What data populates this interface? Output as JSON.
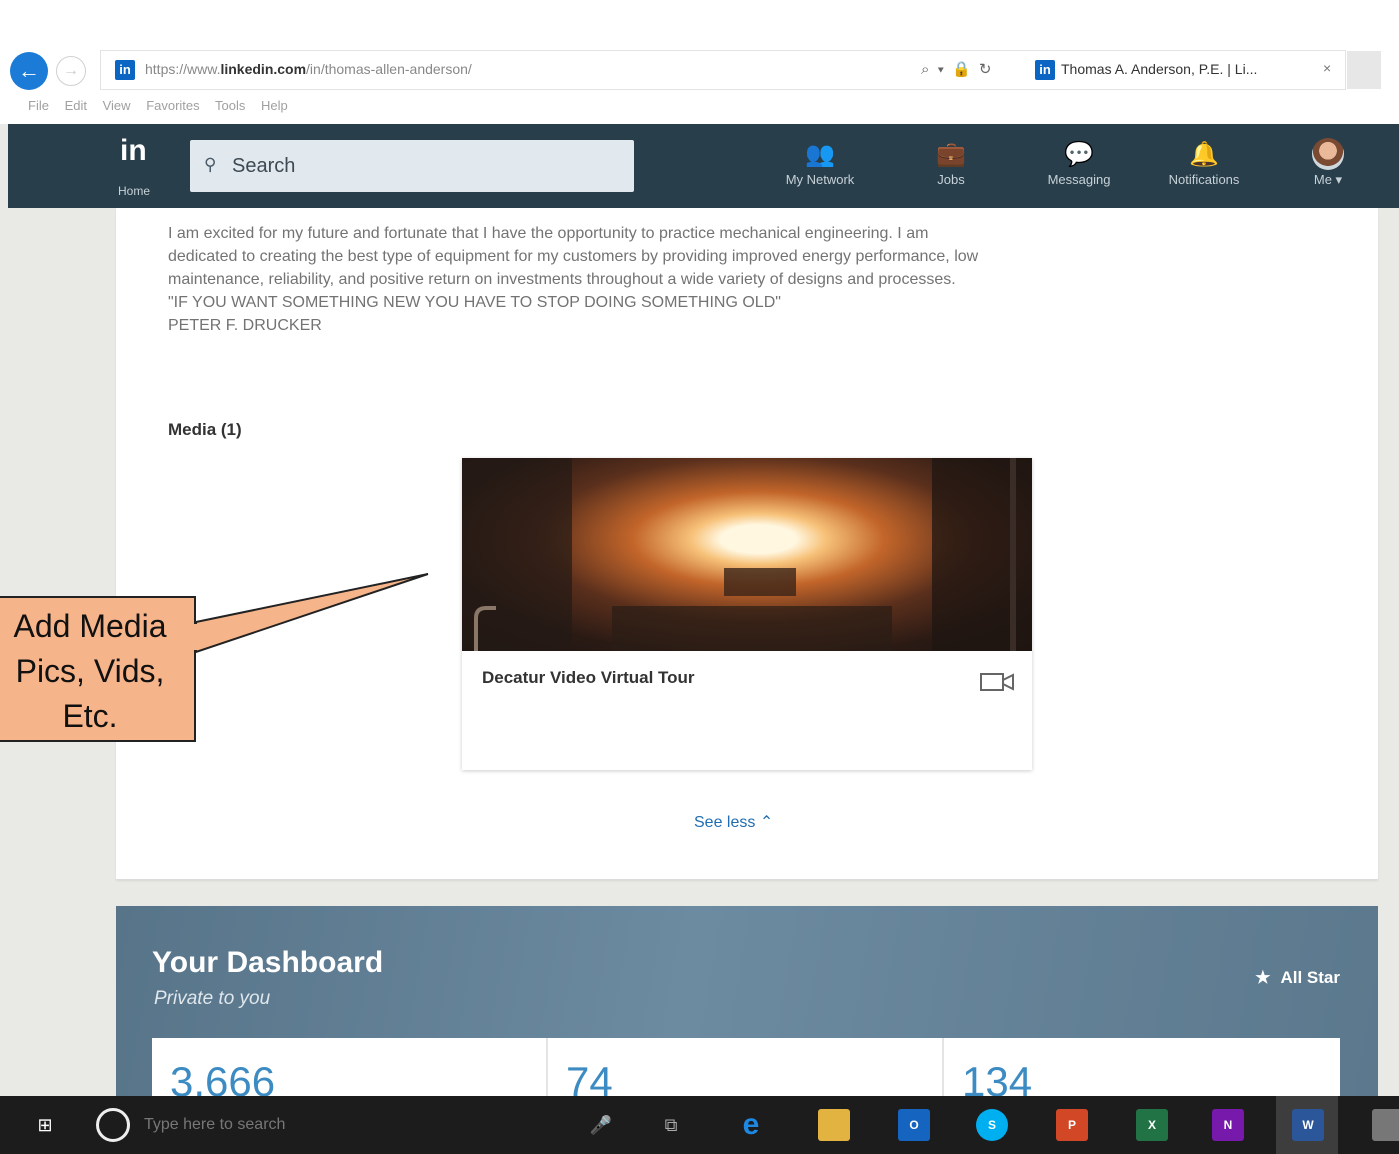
{
  "browser": {
    "url_prefix": "https://www.",
    "url_domain": "linkedin.com",
    "url_path": "/in/thomas-allen-anderson/",
    "address_icons": "⌕ ▾ 🔒 ↻",
    "tab_title": "Thomas A. Anderson, P.E. | Li...",
    "tab_close": "×",
    "menu": [
      "File",
      "Edit",
      "View",
      "Favorites",
      "Tools",
      "Help"
    ]
  },
  "nav": {
    "logo": "in",
    "home_label": "Home",
    "search_placeholder": "Search",
    "items": [
      {
        "label": "My Network",
        "icon": "people-icon"
      },
      {
        "label": "Jobs",
        "icon": "briefcase-icon"
      },
      {
        "label": "Messaging",
        "icon": "chat-icon"
      },
      {
        "label": "Notifications",
        "icon": "bell-icon"
      },
      {
        "label": "Me ▾",
        "icon": "avatar"
      }
    ]
  },
  "summary": {
    "line1": "I am excited for my future and fortunate that I have the opportunity to practice mechanical engineering. I am",
    "line2": "dedicated to creating the best type of equipment for my customers by providing improved energy performance, low",
    "line3": "maintenance, reliability, and positive return on investments throughout a wide variety of designs and processes.",
    "line4": "\"IF YOU WANT SOMETHING NEW YOU HAVE TO STOP DOING SOMETHING OLD\"",
    "line5": "PETER F. DRUCKER"
  },
  "media": {
    "heading": "Media (1)",
    "item_title": "Decatur Video Virtual Tour",
    "see_less": "See less ⌃"
  },
  "callout": {
    "line1": "Add Media",
    "line2": "Pics, Vids,",
    "line3": "Etc."
  },
  "dashboard": {
    "title": "Your Dashboard",
    "subtitle": "Private to you",
    "badge": "All Star",
    "stats": [
      "3,666",
      "74",
      "134"
    ]
  },
  "taskbar": {
    "search_placeholder": "Type here to search"
  }
}
